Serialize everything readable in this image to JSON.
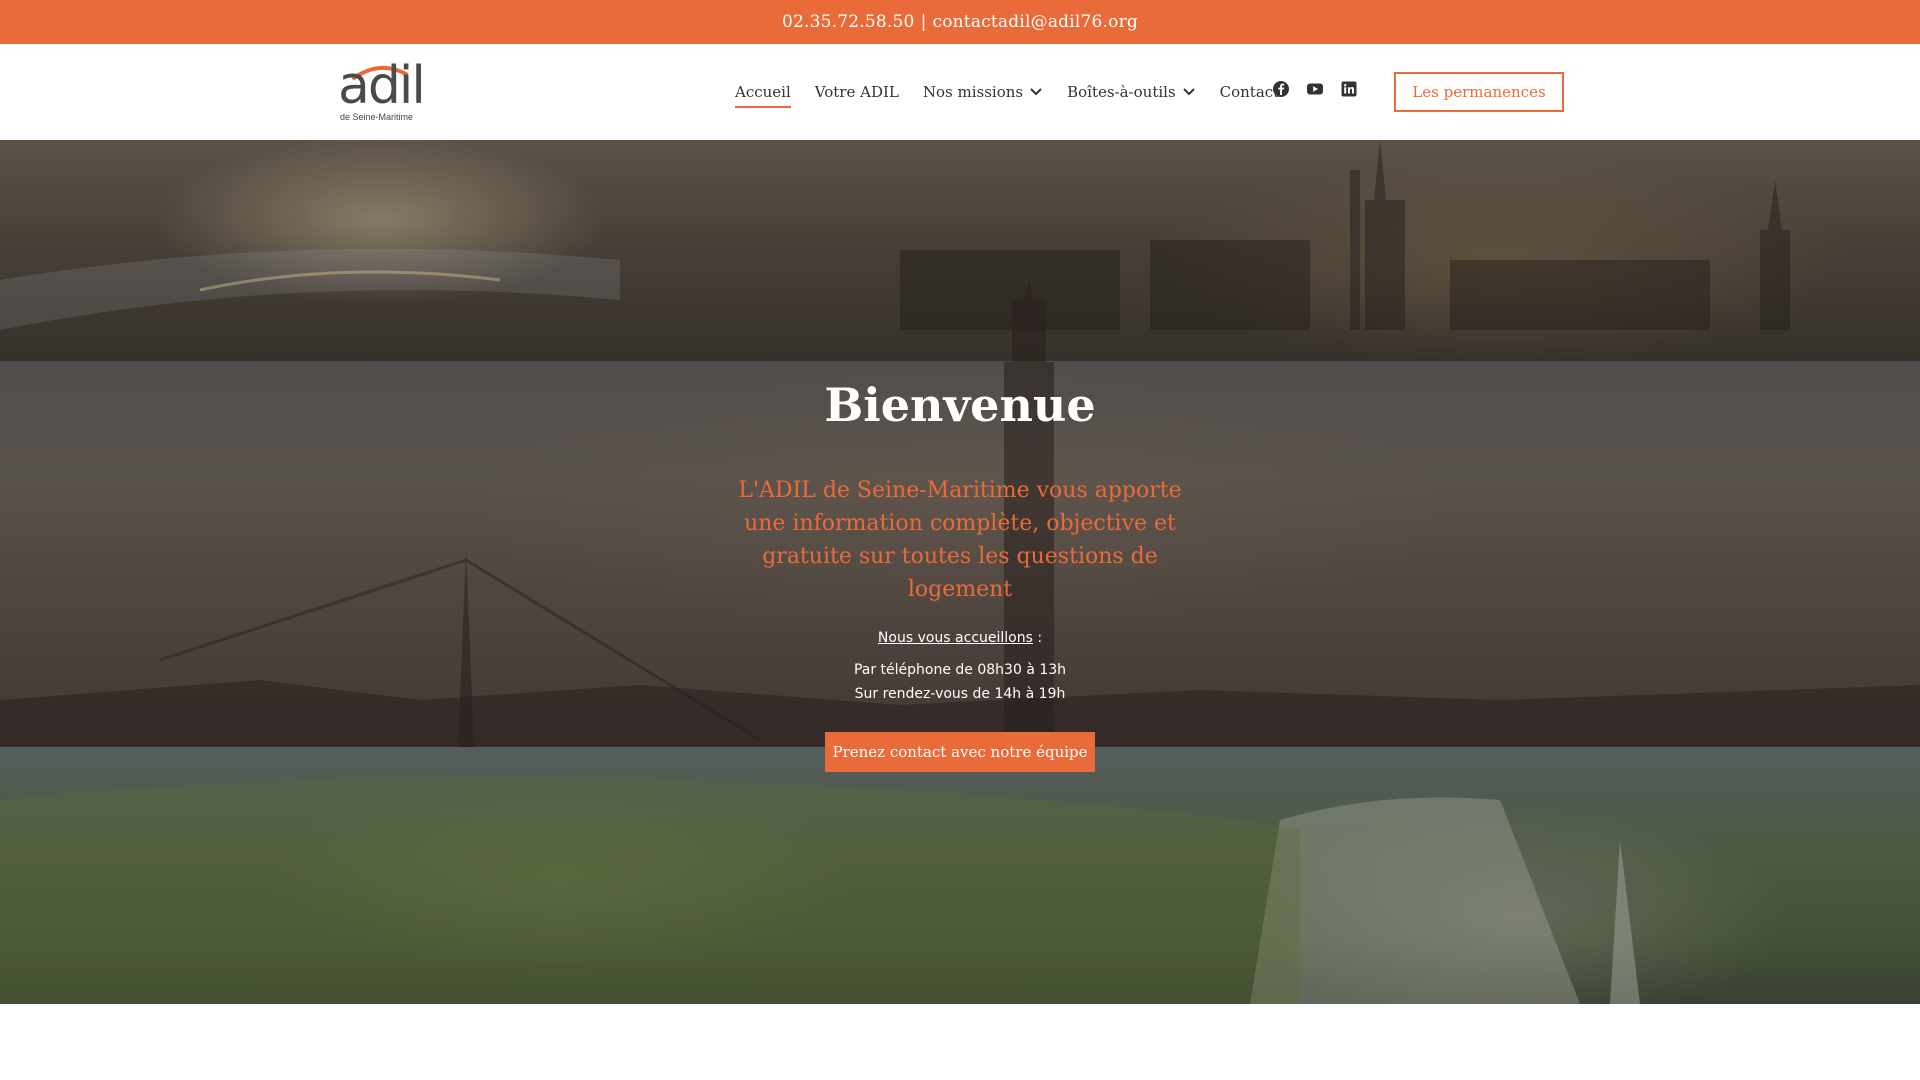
{
  "topbar": {
    "phone": "02.35.72.58.50",
    "separator": "|",
    "email": "contactadil@adil76.org"
  },
  "logo": {
    "name": "adil",
    "subtitle": "de Seine-Maritime"
  },
  "nav": {
    "items": [
      {
        "label": "Accueil",
        "active": true
      },
      {
        "label": "Votre ADIL"
      },
      {
        "label": "Nos missions",
        "dropdown": true
      },
      {
        "label": "Boîtes-à-outils",
        "dropdown": true
      },
      {
        "label": "Contact"
      }
    ]
  },
  "socials": [
    "facebook-icon",
    "youtube-icon",
    "linkedin-icon"
  ],
  "header_cta": "Les permanences",
  "hero": {
    "title": "Bienvenue",
    "lead": "L'ADIL de Seine-Maritime vous apporte une information complète, objective et gratuite sur toutes les questions de logement",
    "welcome_underlined": "Nous vous accueillons",
    "welcome_suffix": " :",
    "line1": "Par téléphone de 08h30 à 13h",
    "line2": "Sur rendez-vous de 14h à 19h",
    "button": "Prenez contact avec notre équipe"
  },
  "colors": {
    "accent": "#e96b3a",
    "text": "#333333",
    "white": "#ffffff"
  }
}
